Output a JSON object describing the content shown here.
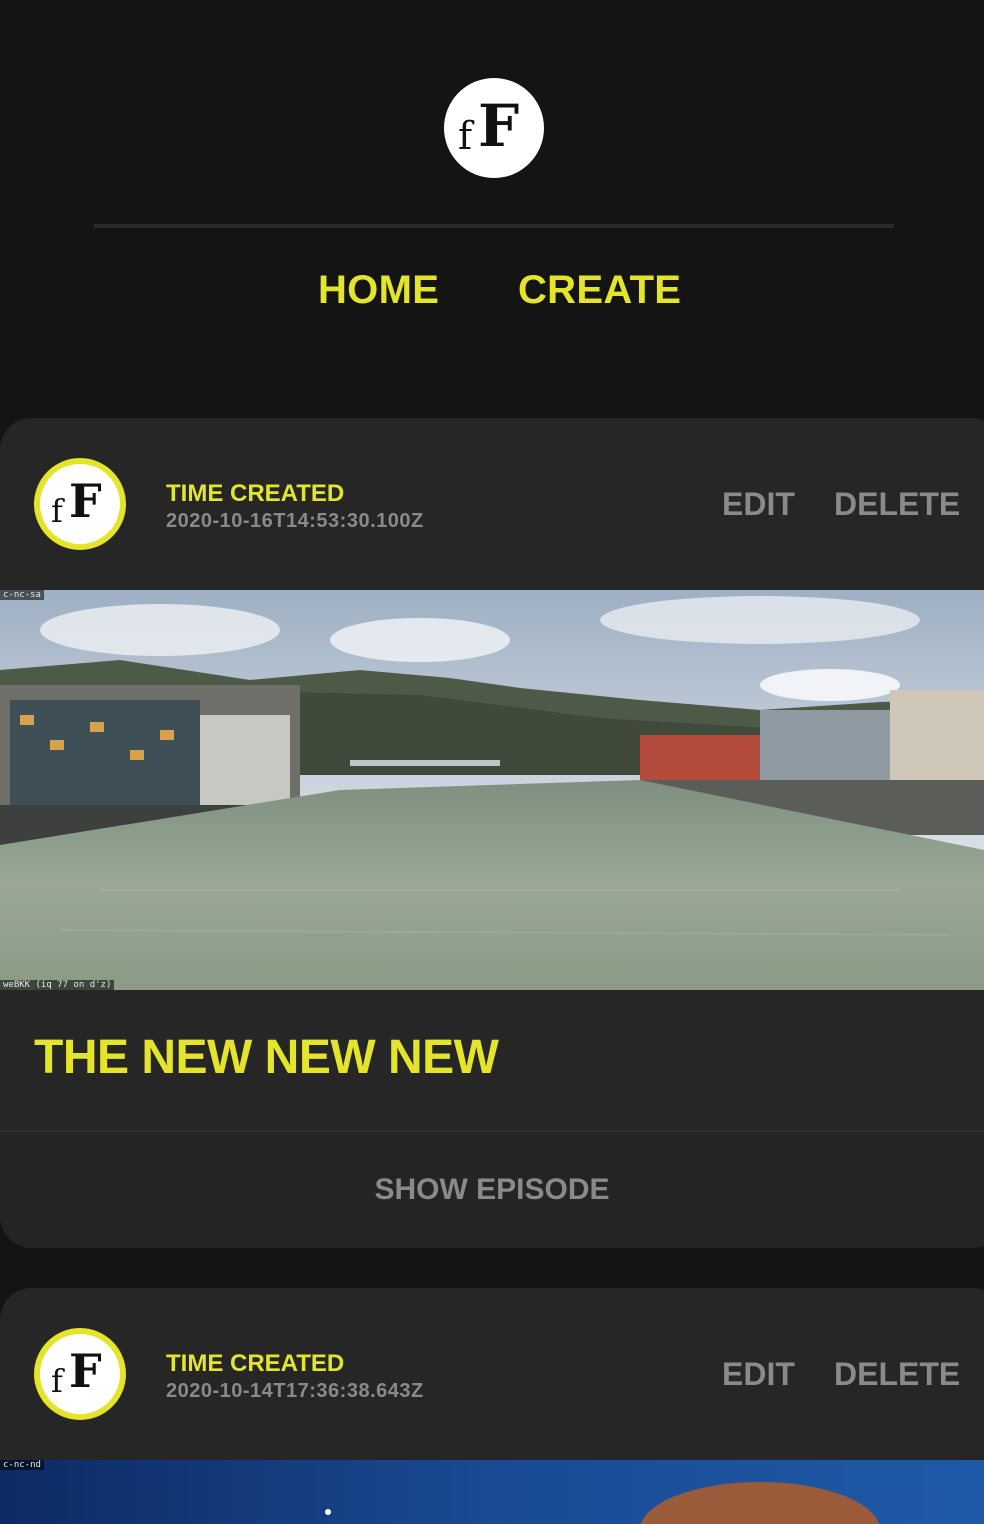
{
  "brand": {
    "logo_small": "f",
    "logo_big": "F"
  },
  "nav": {
    "home": "HOME",
    "create": "CREATE"
  },
  "colors": {
    "accent": "#e4e42a",
    "background": "#141414",
    "card": "#262626",
    "muted": "#8a8a8a"
  },
  "episodes": [
    {
      "time_label": "TIME CREATED",
      "time_value": "2020-10-16T14:53:30.100Z",
      "edit": "EDIT",
      "delete": "DELETE",
      "watermark_top": "c-nc-sa",
      "watermark_bottom": "weBKK (iq 77 on d'z)",
      "title": "THE NEW NEW NEW",
      "show": "SHOW EPISODE"
    },
    {
      "time_label": "TIME CREATED",
      "time_value": "2020-10-14T17:36:38.643Z",
      "edit": "EDIT",
      "delete": "DELETE",
      "watermark_top": "c-nc-nd"
    }
  ]
}
